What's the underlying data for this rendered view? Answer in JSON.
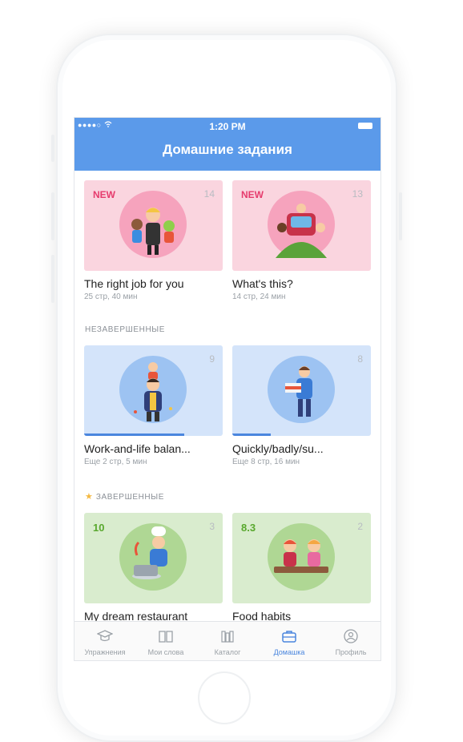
{
  "status_bar": {
    "signal": "●●●●○",
    "time": "1:20 PM"
  },
  "header": {
    "title": "Домашние задания"
  },
  "cards_new": [
    {
      "badge": "NEW",
      "count": "14",
      "title": "The right job for you",
      "subtitle": "25 стр, 40 мин"
    },
    {
      "badge": "NEW",
      "count": "13",
      "title": "What's this?",
      "subtitle": "14 стр, 24 мин"
    }
  ],
  "section_incomplete": "НЕЗАВЕРШЕННЫЕ",
  "cards_incomplete": [
    {
      "count": "9",
      "title": "Work-and-life balan...",
      "subtitle": "Еще 2 стр, 5 мин",
      "progress": 0.72
    },
    {
      "count": "8",
      "title": "Quickly/badly/su...",
      "subtitle": "Еще 8 стр, 16 мин",
      "progress": 0.28
    }
  ],
  "section_complete": "ЗАВЕРШЕННЫЕ",
  "cards_complete": [
    {
      "score": "10",
      "count": "3",
      "title": "My dream restaurant"
    },
    {
      "score": "8.3",
      "count": "2",
      "title": "Food habits"
    }
  ],
  "tabs": [
    {
      "label": "Упражнения",
      "icon": "graduation-cap-icon",
      "active": false
    },
    {
      "label": "Мои слова",
      "icon": "open-book-icon",
      "active": false
    },
    {
      "label": "Каталог",
      "icon": "bookshelf-icon",
      "active": false
    },
    {
      "label": "Домашка",
      "icon": "briefcase-icon",
      "active": true
    },
    {
      "label": "Профиль",
      "icon": "user-circle-icon",
      "active": false
    }
  ],
  "colors": {
    "accent": "#5b9aea",
    "new_badge": "#e63b6d",
    "score": "#59a82e"
  }
}
